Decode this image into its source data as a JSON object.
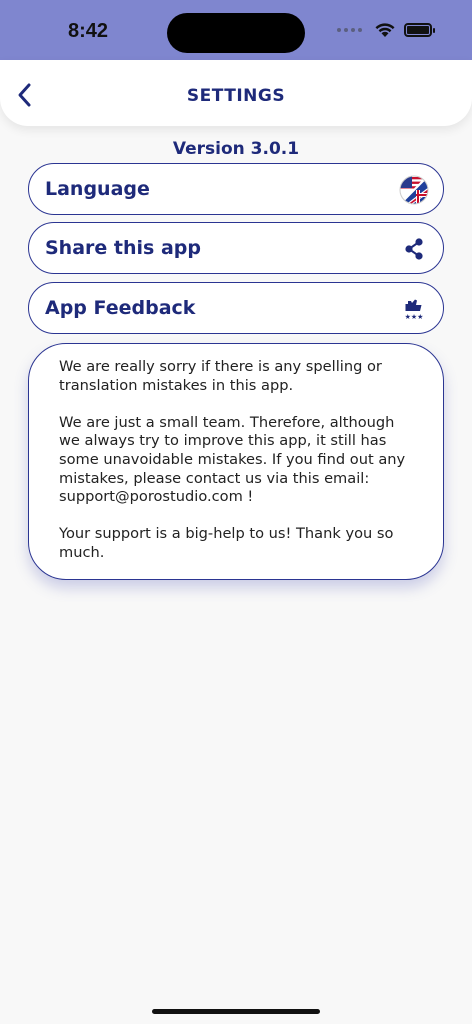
{
  "status": {
    "time": "8:42"
  },
  "header": {
    "title": "SETTINGS"
  },
  "version": "Version 3.0.1",
  "rows": [
    {
      "label": "Language",
      "icon": "uk-us-flag-icon"
    },
    {
      "label": "Share this app",
      "icon": "share-icon"
    },
    {
      "label": "App Feedback",
      "icon": "rating-feedback-icon"
    }
  ],
  "info": {
    "text": "We are really sorry if there is any spelling or translation mistakes in this app.\n\nWe are just a small team. Therefore, although we always try to improve this app, it still has some unavoidable mistakes. If you find out any mistakes, please contact us via this email: support@porostudio.com !\n\nYour support is a big-help to us! Thank you so much."
  },
  "colors": {
    "status_bar": "#7f86cf",
    "accent": "#1e2a7a",
    "border": "#2b3592"
  }
}
